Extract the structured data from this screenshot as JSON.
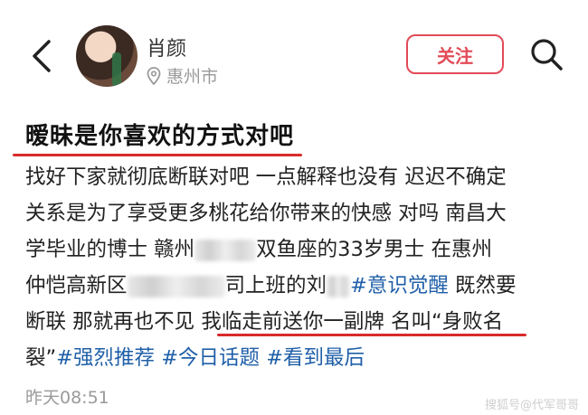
{
  "header": {
    "username": "肖颜",
    "location": "惠州市",
    "follow_label": "关注"
  },
  "post": {
    "title": "暧昧是你喜欢的方式对吧",
    "line1": "找好下家就彻底断联对吧 一点解释也没有 迟迟不确定",
    "line2": "关系是为了享受更多桃花给你带来的快感 对吗 南昌大",
    "line3_a": "学毕业的博士 赣州",
    "line3_b": "双鱼座的33岁男士 在惠州",
    "line4_a": "仲恺高新区",
    "line4_b": "司上班的刘",
    "line4_tag": "#意识觉醒",
    "line4_c": " 既然要",
    "line5_a": "断联 那就再也不见 ",
    "line5_b": "我临走前送你一副牌 名叫“身败名",
    "line6_a": "裂”",
    "tags": [
      "#强烈推荐",
      "#今日话题",
      "#看到最后"
    ],
    "timestamp": "昨天08:51"
  },
  "watermark": "搜狐号@代军哥哥",
  "colors": {
    "accent_red": "#e24b58",
    "underline_red": "#d92b2b",
    "hashtag_blue": "#1f5fa8",
    "muted_gray": "#9a9a9a"
  }
}
